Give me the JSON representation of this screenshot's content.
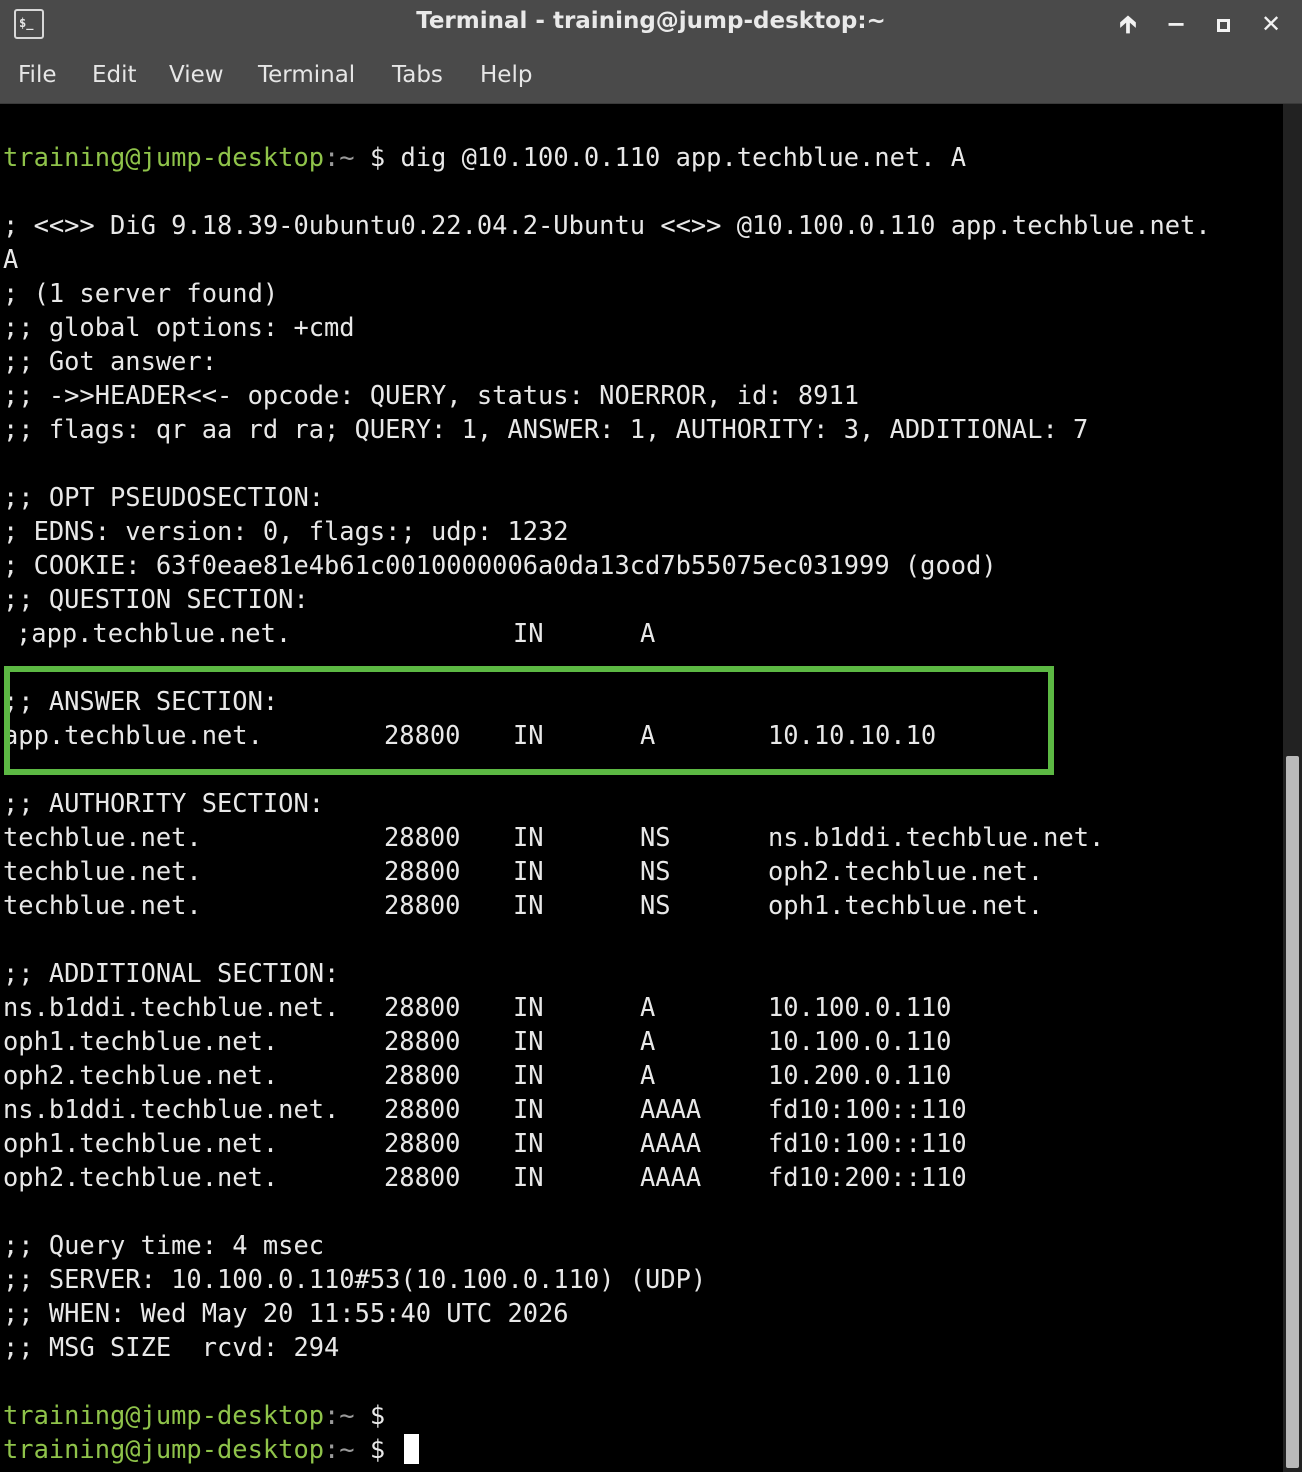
{
  "window": {
    "title": "Terminal - training@jump-desktop:~",
    "app_icon": "$_",
    "controls": [
      "up-arrow-icon",
      "minimize-icon",
      "maximize-icon",
      "close-icon"
    ]
  },
  "menu": [
    "File",
    "Edit",
    "View",
    "Terminal",
    "Tabs",
    "Help"
  ],
  "prompt": {
    "user": "training@jump-desktop",
    "cwd": ":~",
    "symbol": " $ "
  },
  "command": "dig @10.100.0.110 app.techblue.net. A",
  "output": {
    "banner1": "; <<>> DiG 9.18.39-0ubuntu0.22.04.2-Ubuntu <<>> @10.100.0.110 app.techblue.net.",
    "banner2": "A",
    "servers": "; (1 server found)",
    "global": ";; global options: +cmd",
    "got": ";; Got answer:",
    "header": ";; ->>HEADER<<- opcode: QUERY, status: NOERROR, id: 8911",
    "flags": ";; flags: qr aa rd ra; QUERY: 1, ANSWER: 1, AUTHORITY: 3, ADDITIONAL: 7",
    "opt": ";; OPT PSEUDOSECTION:",
    "edns": "; EDNS: version: 0, flags:; udp: 1232",
    "cookie": "; COOKIE: 63f0eae81e4b61c0010000006a0da13cd7b55075ec031999 (good)",
    "question_hdr": ";; QUESTION SECTION:",
    "question": {
      "name": ";app.techblue.net.",
      "class": "IN",
      "type": "A"
    },
    "answer_hdr": ";; ANSWER SECTION:",
    "answer": {
      "name": "app.techblue.net.",
      "ttl": "28800",
      "class": "IN",
      "type": "A",
      "data": "10.10.10.10"
    },
    "authority_hdr": ";; AUTHORITY SECTION:",
    "authority": [
      {
        "name": "techblue.net.",
        "ttl": "28800",
        "class": "IN",
        "type": "NS",
        "data": "ns.b1ddi.techblue.net."
      },
      {
        "name": "techblue.net.",
        "ttl": "28800",
        "class": "IN",
        "type": "NS",
        "data": "oph2.techblue.net."
      },
      {
        "name": "techblue.net.",
        "ttl": "28800",
        "class": "IN",
        "type": "NS",
        "data": "oph1.techblue.net."
      }
    ],
    "additional_hdr": ";; ADDITIONAL SECTION:",
    "additional": [
      {
        "name": "ns.b1ddi.techblue.net.",
        "ttl": "28800",
        "class": "IN",
        "type": "A",
        "data": "10.100.0.110"
      },
      {
        "name": "oph1.techblue.net.",
        "ttl": "28800",
        "class": "IN",
        "type": "A",
        "data": "10.100.0.110"
      },
      {
        "name": "oph2.techblue.net.",
        "ttl": "28800",
        "class": "IN",
        "type": "A",
        "data": "10.200.0.110"
      },
      {
        "name": "ns.b1ddi.techblue.net.",
        "ttl": "28800",
        "class": "IN",
        "type": "AAAA",
        "data": "fd10:100::110"
      },
      {
        "name": "oph1.techblue.net.",
        "ttl": "28800",
        "class": "IN",
        "type": "AAAA",
        "data": "fd10:100::110"
      },
      {
        "name": "oph2.techblue.net.",
        "ttl": "28800",
        "class": "IN",
        "type": "AAAA",
        "data": "fd10:200::110"
      }
    ],
    "query_time": ";; Query time: 4 msec",
    "server": ";; SERVER: 10.100.0.110#53(10.100.0.110) (UDP)",
    "when": ";; WHEN: Wed May 20 11:55:40 UTC 2026",
    "msg_size": ";; MSG SIZE  rcvd: 294"
  },
  "colors": {
    "prompt": "#8fc34a",
    "highlight": "#5cb843",
    "titlebar": "#4a4a4a"
  }
}
